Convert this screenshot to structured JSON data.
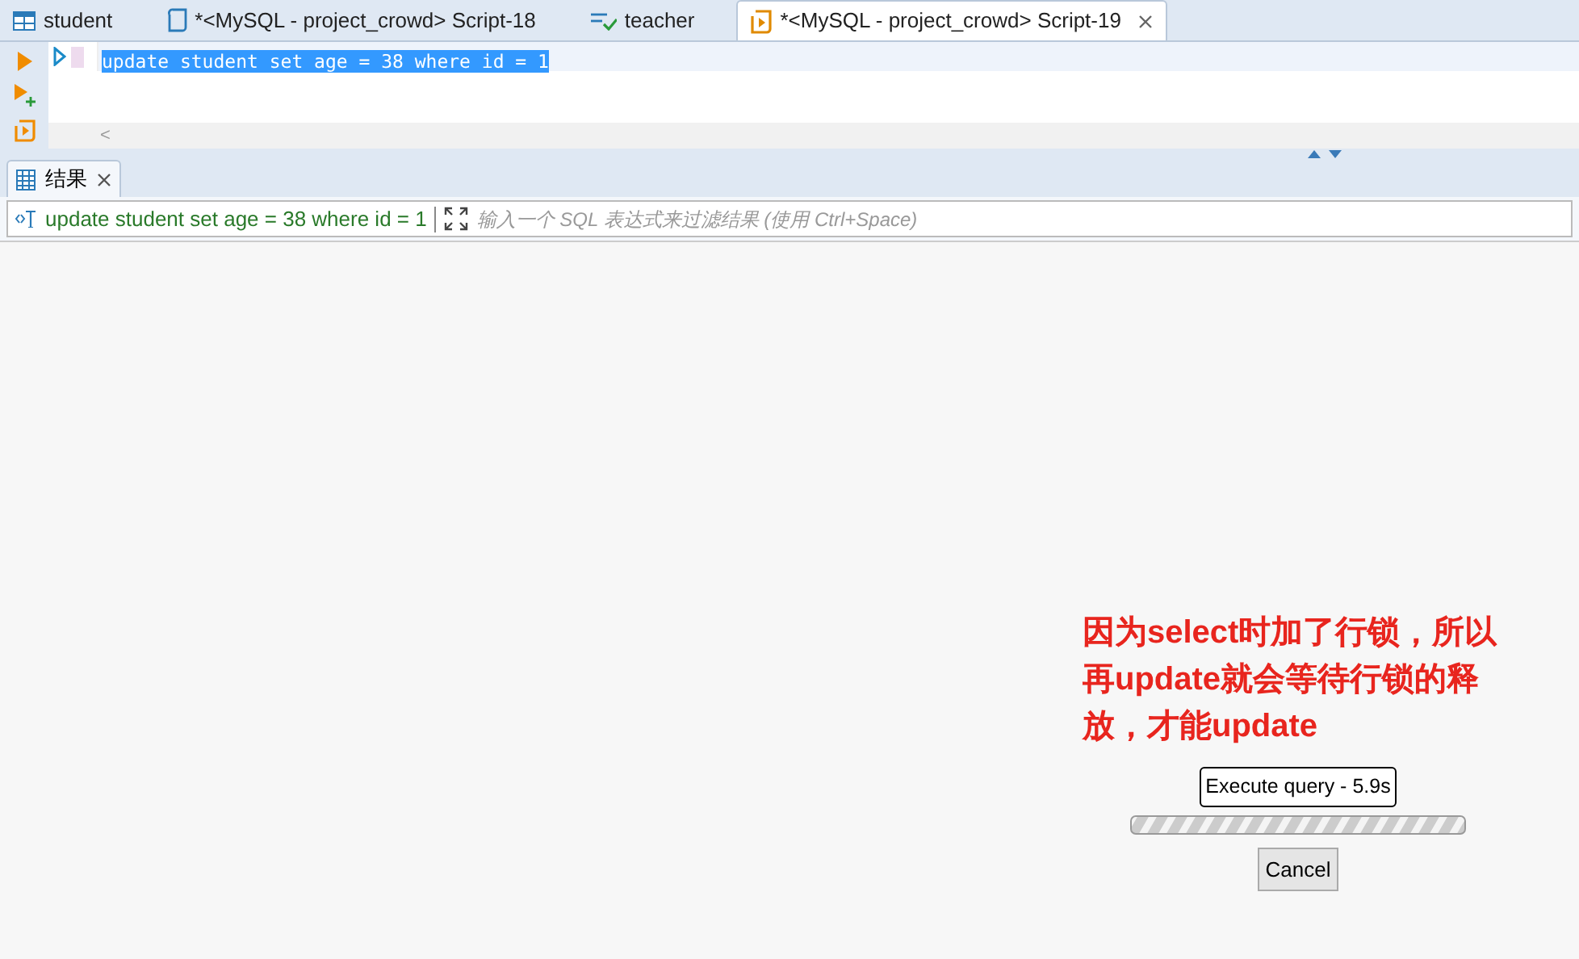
{
  "editor_tabs": [
    {
      "label": "student",
      "kind": "table",
      "selected": false,
      "closable": false
    },
    {
      "label": "*<MySQL - project_crowd> Script-18",
      "kind": "script",
      "selected": false,
      "closable": false
    },
    {
      "label": "teacher",
      "kind": "view",
      "selected": false,
      "closable": false
    },
    {
      "label": "*<MySQL - project_crowd> Script-19",
      "kind": "script-active",
      "selected": true,
      "closable": true
    }
  ],
  "editor": {
    "lines": [
      {
        "text": "update student set age = 38 where id = 1",
        "selected": true
      }
    ],
    "scroll_left": "<"
  },
  "results_tab": {
    "label": "结果",
    "selected": true
  },
  "filter": {
    "query": "update student set age = 38 where id = 1",
    "placeholder": "输入一个 SQL 表达式来过滤结果 (使用 Ctrl+Space)"
  },
  "annotation": "因为select时加了行锁，所以再update就会等待行锁的释放，才能update",
  "progress": {
    "label": "Execute query - 5.9s",
    "indeterminate": true,
    "cancel": "Cancel"
  }
}
